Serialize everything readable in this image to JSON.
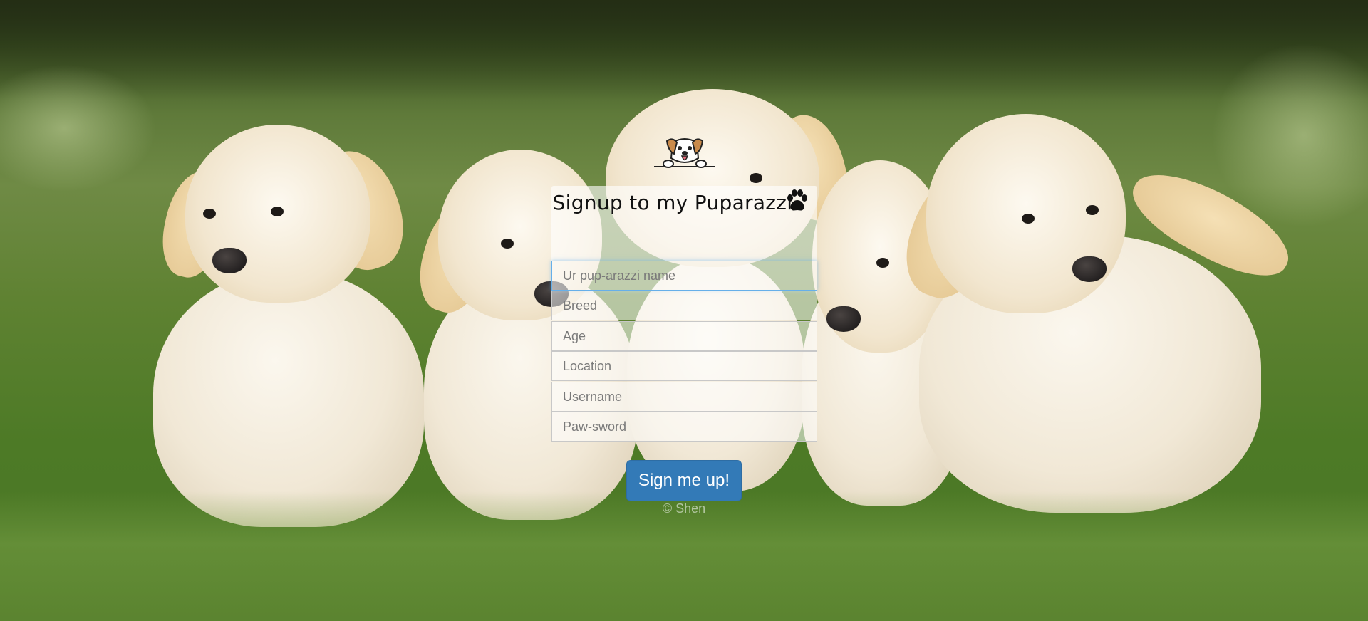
{
  "signup": {
    "title": "Signup to my Puparazzi",
    "fields": [
      {
        "placeholder": "Ur pup-arazzi name",
        "value": ""
      },
      {
        "placeholder": "Breed",
        "value": ""
      },
      {
        "placeholder": "Age",
        "value": ""
      },
      {
        "placeholder": "Location",
        "value": ""
      },
      {
        "placeholder": "Username",
        "value": ""
      },
      {
        "placeholder": "Paw-sword",
        "value": ""
      }
    ],
    "submit_label": "Sign me up!",
    "footer_text": "© Shen"
  },
  "icons": {
    "logo": "dog-peeking-icon",
    "paw": "paw-print-icon"
  },
  "colors": {
    "button": "#337ab7",
    "focus_border": "#66afe9"
  }
}
